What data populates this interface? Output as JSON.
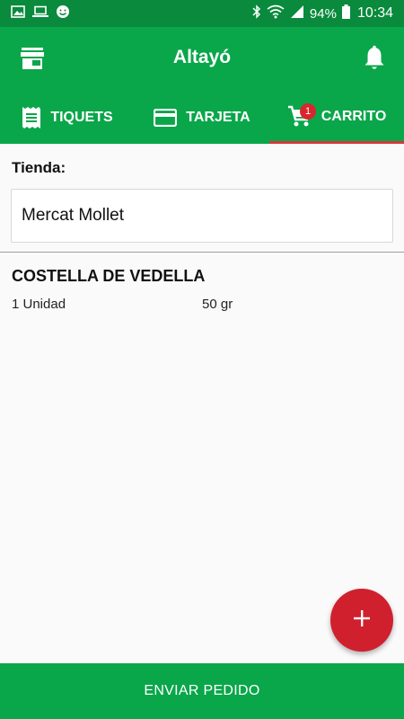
{
  "status_bar": {
    "battery_percent": "94%",
    "time": "10:34",
    "left_icons": [
      "image-icon",
      "laptop-icon",
      "smiley-icon"
    ],
    "right_icons": [
      "bluetooth-icon",
      "wifi-icon",
      "signal-icon",
      "battery-icon"
    ]
  },
  "app_bar": {
    "title": "Altayó",
    "left_icon": "store-icon",
    "right_icon": "bell-icon"
  },
  "tabs": [
    {
      "label": "TIQUETS",
      "icon": "receipt-icon",
      "active": false
    },
    {
      "label": "TARJETA",
      "icon": "card-icon",
      "active": false
    },
    {
      "label": "CARRITO",
      "icon": "cart-icon",
      "active": true,
      "badge": "1"
    }
  ],
  "store": {
    "label": "Tienda:",
    "value": "Mercat Mollet"
  },
  "cart_items": [
    {
      "name": "COSTELLA DE VEDELLA",
      "quantity": "1 Unidad",
      "weight": "50 gr"
    }
  ],
  "fab": {
    "icon": "plus-icon"
  },
  "bottom_button": {
    "label": "ENVIAR PEDIDO"
  },
  "colors": {
    "primary": "#0aa64a",
    "status_bar": "#098a3c",
    "accent": "#d0202e"
  }
}
